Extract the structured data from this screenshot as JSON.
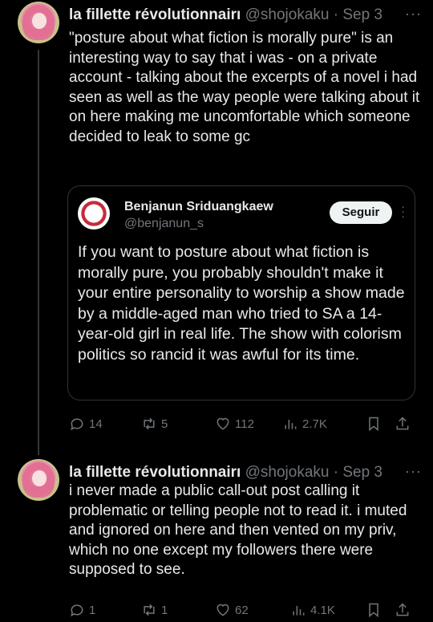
{
  "posts": [
    {
      "display_name": "la fillette révolutionnairı",
      "handle": "@shojokaku",
      "separator": "·",
      "date": "Sep 3",
      "more_label": "···",
      "text": "\"posture about what fiction is morally pure\" is an interesting way to say that i was - on a private account - talking about the excerpts of a novel i had seen as well as the way people were talking about it on here making me uncomfortable which someone decided to leak to some gc",
      "quote": {
        "display_name": "Benjanun Sriduangkaew",
        "handle": "@benjanun_s",
        "follow_label": "Seguir",
        "text": "If you want to posture about what fiction is morally pure, you probably shouldn't make it your entire personality to worship a show made by a middle-aged man who tried to SA a 14-year-old girl in real life. The show with colorism politics so rancid it was awful for its time."
      },
      "stats": {
        "replies": "14",
        "reposts": "5",
        "likes": "112",
        "views": "2.7K"
      }
    },
    {
      "display_name": "la fillette révolutionnairı",
      "handle": "@shojokaku",
      "separator": "·",
      "date": "Sep 3",
      "more_label": "···",
      "text": "i never made a public call-out post calling it problematic or telling people not to read it. i muted and ignored on here and then vented on my priv, which no one except my followers there were supposed to see.",
      "stats": {
        "replies": "1",
        "reposts": "1",
        "likes": "62",
        "views": "4.1K"
      }
    }
  ],
  "icons": [
    "reply-icon",
    "repost-icon",
    "like-icon",
    "views-icon",
    "bookmark-icon",
    "share-icon"
  ],
  "colors": {
    "background": "#000000",
    "text": "#e7e9ea",
    "muted": "#71767b",
    "border": "#2f3336"
  }
}
